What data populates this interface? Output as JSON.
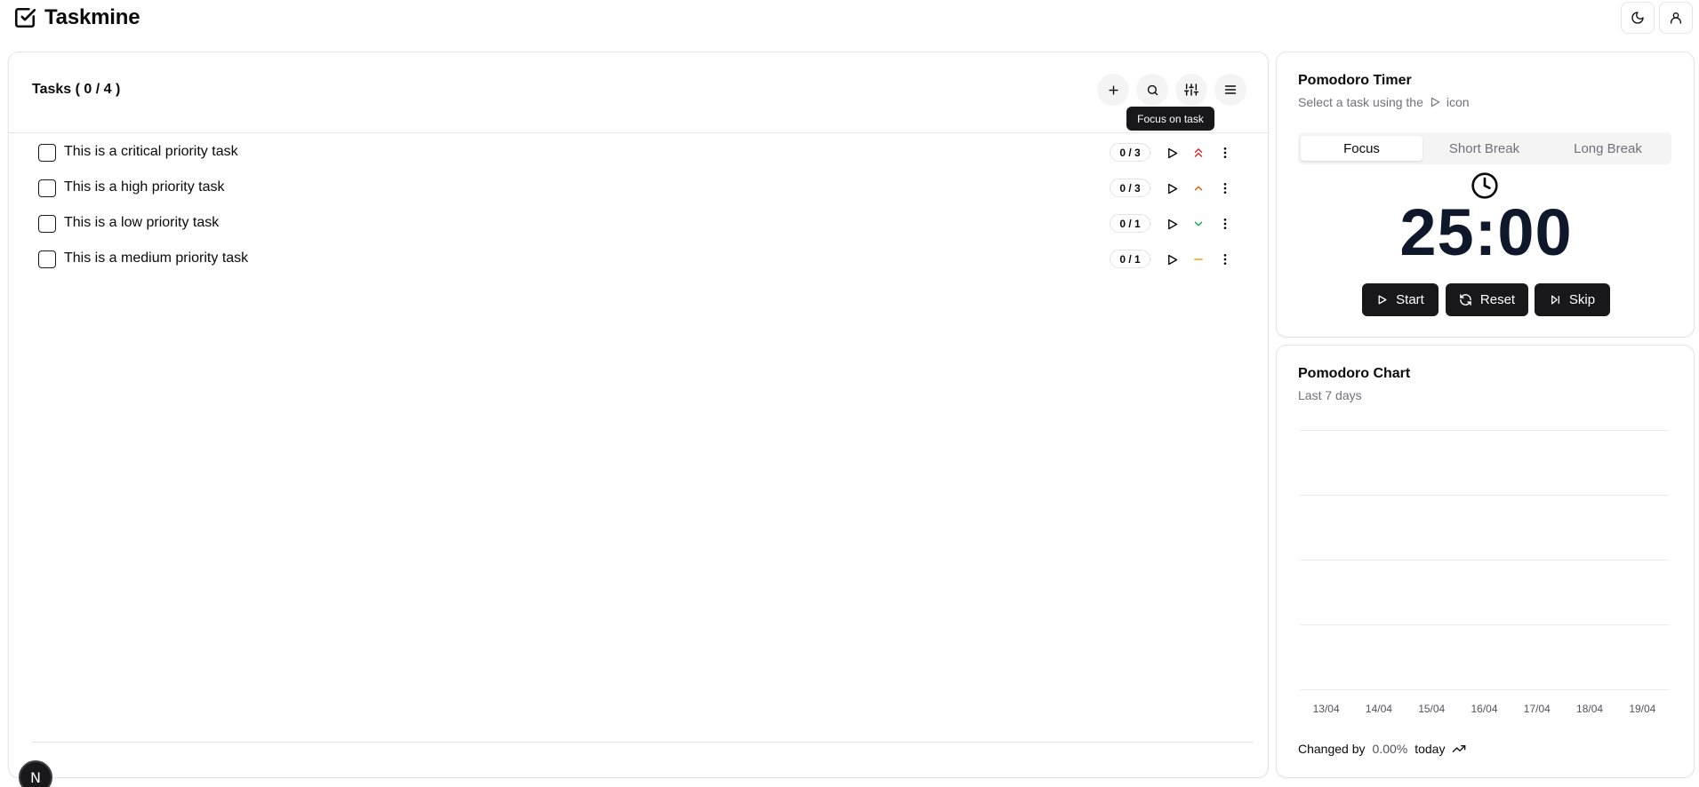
{
  "app": {
    "title": "Taskmine"
  },
  "header": {
    "theme_icon": "moon-icon",
    "user_icon": "user-icon"
  },
  "tasks": {
    "title": "Tasks ( 0 / 4 )",
    "tooltip": "Focus on task",
    "toolbar_icons": [
      "plus-icon",
      "search-icon",
      "sliders-icon",
      "menu-icon"
    ],
    "items": [
      {
        "label": "This is a critical priority task",
        "count": "0 / 3",
        "priority": "critical",
        "priority_color": "#dc2626"
      },
      {
        "label": "This is a high priority task",
        "count": "0 / 3",
        "priority": "high",
        "priority_color": "#ea580c"
      },
      {
        "label": "This is a low priority task",
        "count": "0 / 1",
        "priority": "low",
        "priority_color": "#16a34a"
      },
      {
        "label": "This is a medium priority task",
        "count": "0 / 1",
        "priority": "medium",
        "priority_color": "#f59e0b"
      }
    ]
  },
  "timer": {
    "title": "Pomodoro Timer",
    "subtitle_before": "Select a task using the",
    "subtitle_after": "icon",
    "tabs": [
      "Focus",
      "Short Break",
      "Long Break"
    ],
    "active_tab": "Focus",
    "display": "25:00",
    "buttons": {
      "start": "Start",
      "reset": "Reset",
      "skip": "Skip"
    }
  },
  "chart": {
    "title": "Pomodoro Chart",
    "subtitle": "Last 7 days",
    "changed_prefix": "Changed by",
    "changed_value": "0.00%",
    "changed_suffix": "today"
  },
  "chart_data": {
    "type": "bar",
    "categories": [
      "13/04",
      "14/04",
      "15/04",
      "16/04",
      "17/04",
      "18/04",
      "19/04"
    ],
    "values": [
      0,
      0,
      0,
      0,
      0,
      0,
      0
    ],
    "title": "Pomodoro Chart",
    "subtitle": "Last 7 days",
    "xlabel": "",
    "ylabel": "",
    "grid": true
  },
  "dev_badge": {
    "label": "N"
  }
}
